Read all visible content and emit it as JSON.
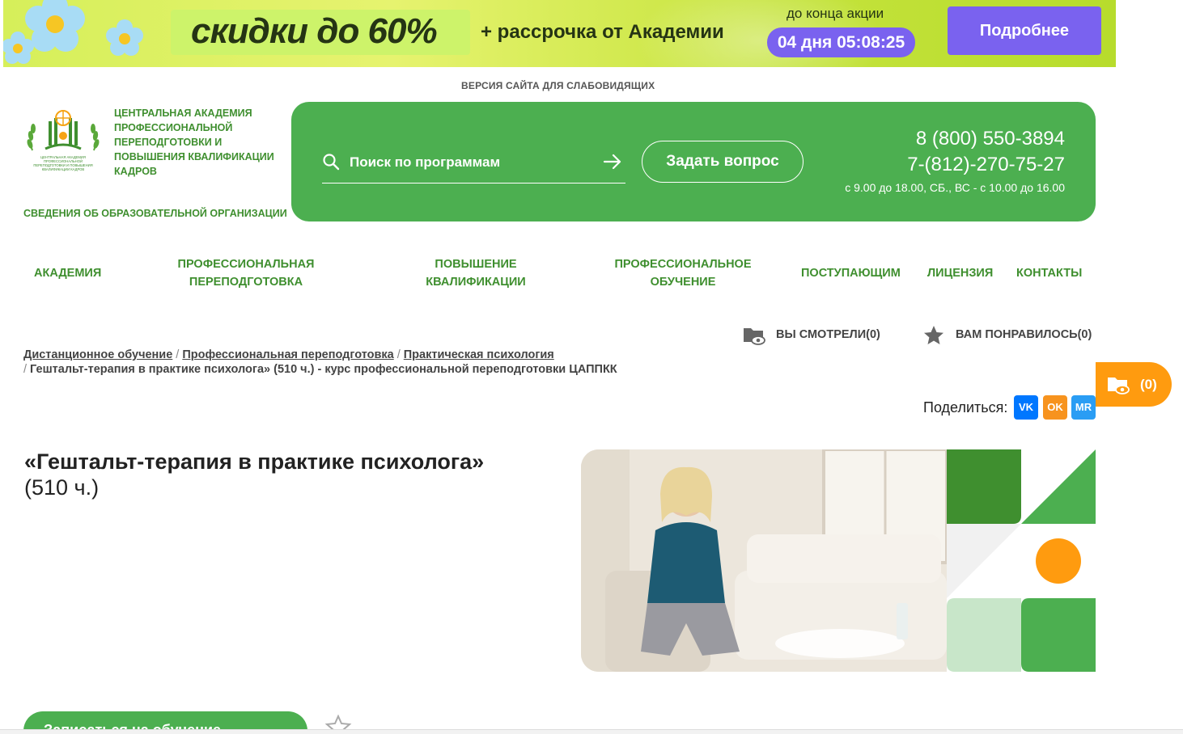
{
  "banner": {
    "sale": "скидки до 60%",
    "installment": "+ рассрочка от Академии",
    "until_label": "до конца акции",
    "timer": "04 дня 05:08:25",
    "more_button": "Подробнее",
    "colors": {
      "accent": "#7a62ef",
      "background": "#d6ef5a"
    }
  },
  "accessibility_link": "ВЕРСИЯ САЙТА ДЛЯ СЛАБОВИДЯЩИХ",
  "logo": {
    "title": "ЦЕНТРАЛЬНАЯ АКАДЕМИЯ ПРОФЕССИОНАЛЬНОЙ ПЕРЕПОДГОТОВКИ И ПОВЫШЕНИЯ КВАЛИФИКАЦИИ КАДРОВ",
    "emblem_caption": "ЦЕНТРАЛЬНАЯ АКАДЕМИЯ ПРОФЕССИОНАЛЬНОЙ ПЕРЕПОДГОТОВКИ И ПОВЫШЕНИЯ КВАЛИФИКАЦИИ КАДРОВ"
  },
  "org_info_link": "СВЕДЕНИЯ ОБ ОБРАЗОВАТЕЛЬНОЙ ОРГАНИЗАЦИИ",
  "header": {
    "search_placeholder": "Поиск по программам",
    "ask_button": "Задать вопрос",
    "phone1": "8 (800) 550-3894",
    "phone2": "7-(812)-270-75-27",
    "hours": "с 9.00 до 18.00, СБ., ВС - с 10.00 до 16.00",
    "color": "#4caf50"
  },
  "nav": {
    "academy": "АКАДЕМИЯ",
    "retraining": "ПРОФЕССИОНАЛЬНАЯ ПЕРЕПОДГОТОВКА",
    "qualification": "ПОВЫШЕНИЕ КВАЛИФИКАЦИИ",
    "training": "ПРОФЕССИОНАЛЬНОЕ ОБУЧЕНИЕ",
    "applicants": "ПОСТУПАЮЩИМ",
    "license": "ЛИЦЕНЗИЯ",
    "contacts": "КОНТАКТЫ"
  },
  "viewed": "ВЫ СМОТРЕЛИ(0)",
  "liked": "ВАМ ПОНРАВИЛОСЬ(0)",
  "breadcrumbs": {
    "items": [
      "Дистанционное обучение",
      "Профессиональная переподготовка",
      "Практическая психология"
    ],
    "current": "Гештальт-терапия в практике психолога» (510 ч.) - курс профессиональной переподготовки ЦАППКК"
  },
  "floating_basket": {
    "count": "(0)",
    "color": "#ff9b0f"
  },
  "share": {
    "label": "Поделиться:",
    "vk": "VK",
    "ok": "OK",
    "mail": "MR"
  },
  "course": {
    "title": "«Гештальт-терапия в практике психолога»",
    "hours": "(510 ч.)"
  },
  "cta": "Записаться на обучение"
}
